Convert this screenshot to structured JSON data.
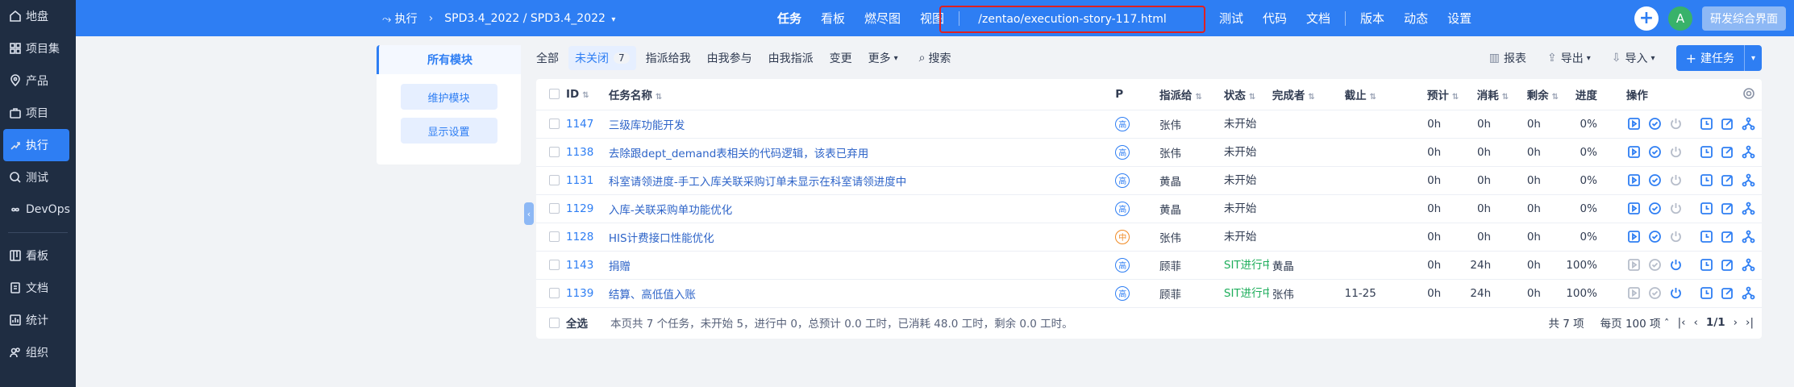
{
  "sidebar": {
    "items": [
      {
        "label": "地盘",
        "icon": "home-icon"
      },
      {
        "label": "项目集",
        "icon": "grid-icon"
      },
      {
        "label": "产品",
        "icon": "map-pin-icon"
      },
      {
        "label": "项目",
        "icon": "briefcase-icon"
      },
      {
        "label": "执行",
        "icon": "run-icon",
        "active": true
      },
      {
        "label": "测试",
        "icon": "search-check-icon"
      },
      {
        "label": "DevOps",
        "icon": "infinity-icon"
      },
      {
        "label": "看板",
        "icon": "kanban-icon"
      },
      {
        "label": "文档",
        "icon": "document-icon"
      },
      {
        "label": "统计",
        "icon": "chart-icon"
      },
      {
        "label": "组织",
        "icon": "users-icon"
      }
    ]
  },
  "header": {
    "module": "执行",
    "breadcrumb_1": "SPD3.4_2022",
    "breadcrumb_2": "SPD3.4_2022",
    "tabs": [
      "任务",
      "看板",
      "燃尽图",
      "视图"
    ],
    "url": "/zentao/execution-story-117.html",
    "tabs2": [
      "测试",
      "代码",
      "文档"
    ],
    "tabs3": [
      "版本",
      "动态",
      "设置"
    ],
    "avatar": "A",
    "view_button": "研发综合界面"
  },
  "module_panel": {
    "title": "所有模块",
    "maintain": "维护模块",
    "display": "显示设置"
  },
  "toolbar": {
    "filters": [
      "全部",
      "未关闭",
      "指派给我",
      "由我参与",
      "由我指派",
      "变更",
      "更多"
    ],
    "unclosed_count": "7",
    "search": "搜索",
    "report": "报表",
    "export": "导出",
    "import": "导入",
    "create": "建任务"
  },
  "table": {
    "columns": [
      "ID",
      "任务名称",
      "P",
      "指派给",
      "状态",
      "完成者",
      "截止",
      "预计",
      "消耗",
      "剩余",
      "进度",
      "操作"
    ],
    "rows": [
      {
        "id": "1147",
        "name": "三级库功能开发",
        "pri": "高",
        "assigned": "张伟",
        "status": "未开始",
        "finisher": "",
        "deadline": "",
        "estimate": "0h",
        "consumed": "0h",
        "left": "0h",
        "progress": "0%"
      },
      {
        "id": "1138",
        "name": "去除跟dept_demand表相关的代码逻辑，该表已弃用",
        "pri": "高",
        "assigned": "张伟",
        "status": "未开始",
        "finisher": "",
        "deadline": "",
        "estimate": "0h",
        "consumed": "0h",
        "left": "0h",
        "progress": "0%"
      },
      {
        "id": "1131",
        "name": "科室请领进度-手工入库关联采购订单未显示在科室请领进度中",
        "pri": "高",
        "assigned": "黄晶",
        "status": "未开始",
        "finisher": "",
        "deadline": "",
        "estimate": "0h",
        "consumed": "0h",
        "left": "0h",
        "progress": "0%"
      },
      {
        "id": "1129",
        "name": "入库-关联采购单功能优化",
        "pri": "高",
        "assigned": "黄晶",
        "status": "未开始",
        "finisher": "",
        "deadline": "",
        "estimate": "0h",
        "consumed": "0h",
        "left": "0h",
        "progress": "0%"
      },
      {
        "id": "1128",
        "name": "HIS计费接口性能优化",
        "pri": "中",
        "assigned": "张伟",
        "status": "未开始",
        "finisher": "",
        "deadline": "",
        "estimate": "0h",
        "consumed": "0h",
        "left": "0h",
        "progress": "0%"
      },
      {
        "id": "1143",
        "name": "捐赠",
        "pri": "高",
        "assigned": "顾菲",
        "status": "SIT进行中",
        "finisher": "黄晶",
        "deadline": "",
        "estimate": "0h",
        "consumed": "24h",
        "left": "0h",
        "progress": "100%"
      },
      {
        "id": "1139",
        "name": "结算、高低值入账",
        "pri": "高",
        "assigned": "顾菲",
        "status": "SIT进行中",
        "finisher": "张伟",
        "deadline": "11-25",
        "estimate": "0h",
        "consumed": "24h",
        "left": "0h",
        "progress": "100%"
      }
    ],
    "select_all": "全选",
    "summary": "本页共 7 个任务，未开始 5，进行中 0，总预计 0.0 工时，已消耗 48.0 工时，剩余 0.0 工时。",
    "total": "共 7 项",
    "per_page": "每页 100 项",
    "page": "1/1"
  }
}
